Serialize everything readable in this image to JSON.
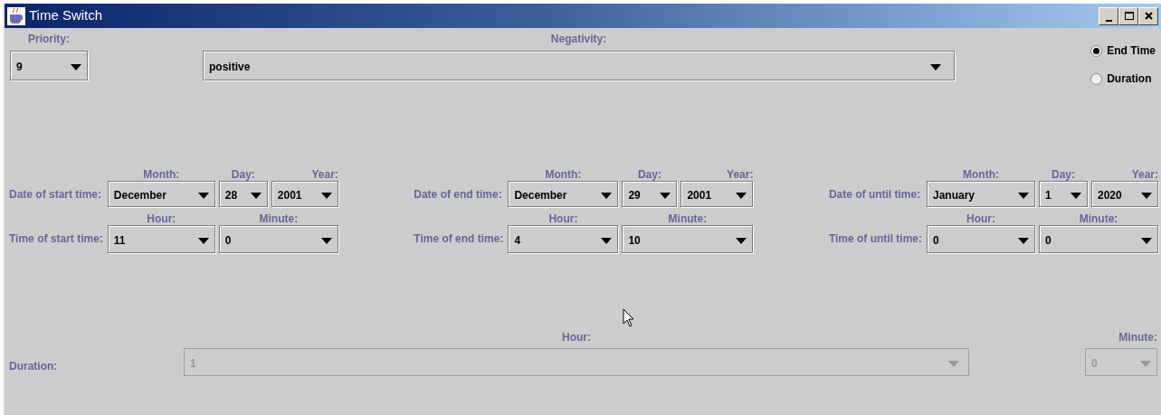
{
  "window": {
    "title": "Time Switch"
  },
  "priority": {
    "label": "Priority:",
    "value": "9"
  },
  "negativity": {
    "label": "Negativity:",
    "value": "positive"
  },
  "mode_options": [
    {
      "label": "End Time",
      "selected": true
    },
    {
      "label": "Duration",
      "selected": false
    }
  ],
  "time_groups": [
    {
      "date_label": "Date of start time:",
      "month_label": "Month:",
      "month": "December",
      "day_label": "Day:",
      "day": "28",
      "year_label": "Year:",
      "year": "2001",
      "time_label": "Time of start time:",
      "hour_label": "Hour:",
      "hour": "11",
      "minute_label": "Minute:",
      "minute": "0"
    },
    {
      "date_label": "Date of end time:",
      "month_label": "Month:",
      "month": "December",
      "day_label": "Day:",
      "day": "29",
      "year_label": "Year:",
      "year": "2001",
      "time_label": "Time of end time:",
      "hour_label": "Hour:",
      "hour": "4",
      "minute_label": "Minute:",
      "minute": "10"
    },
    {
      "date_label": "Date of until time:",
      "month_label": "Month:",
      "month": "January",
      "day_label": "Day:",
      "day": "1",
      "year_label": "Year:",
      "year": "2020",
      "time_label": "Time of until time:",
      "hour_label": "Hour:",
      "hour": "0",
      "minute_label": "Minute:",
      "minute": "0"
    }
  ],
  "duration": {
    "label": "Duration:",
    "hour_label": "Hour:",
    "hour": "1",
    "minute_label": "Minute:",
    "minute": "0",
    "disabled": true
  }
}
